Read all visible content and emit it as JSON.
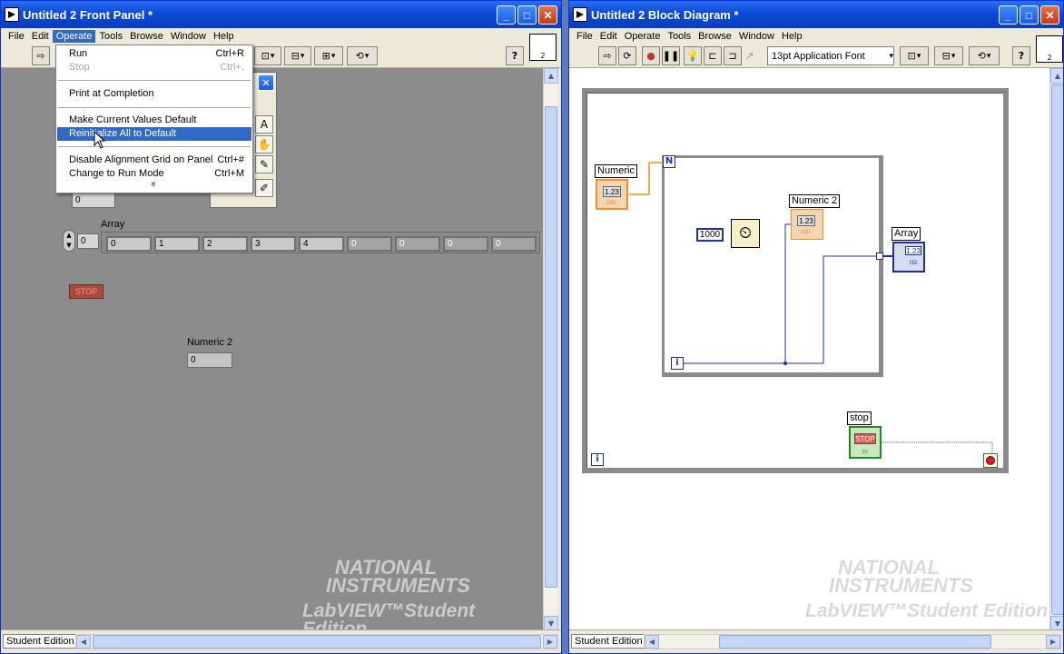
{
  "front_panel": {
    "title": "Untitled 2 Front Panel *",
    "menu": [
      "File",
      "Edit",
      "Operate",
      "Tools",
      "Browse",
      "Window",
      "Help"
    ],
    "operate_menu": {
      "run": "Run",
      "run_sc": "Ctrl+R",
      "stop": "Stop",
      "stop_sc": "Ctrl+.",
      "print": "Print at Completion",
      "make_default": "Make Current Values Default",
      "reinit": "Reinitialize All to Default",
      "disable_grid": "Disable Alignment Grid on Panel",
      "disable_grid_sc": "Ctrl+#",
      "run_mode": "Change to Run Mode",
      "run_mode_sc": "Ctrl+M",
      "more": "»"
    },
    "numeric_value": "0",
    "array_label": "Array",
    "array_index": "0",
    "array_values": [
      "0",
      "1",
      "2",
      "3",
      "4",
      "0",
      "0",
      "0",
      "0"
    ],
    "stop_label": "STOP",
    "numeric2_label": "Numeric 2",
    "numeric2_value": "0",
    "statusbar_label": "Student Edition",
    "vi_icon_number": "2",
    "watermark_line1": "NATIONAL",
    "watermark_line2": "INSTRUMENTS",
    "watermark_line3": "LabVIEW™Student Edition"
  },
  "block_diagram": {
    "title": "Untitled 2 Block Diagram *",
    "menu": [
      "File",
      "Edit",
      "Operate",
      "Tools",
      "Browse",
      "Window",
      "Help"
    ],
    "font_select": "13pt Application Font",
    "numeric_label": "Numeric",
    "numeric_term": "1.23",
    "numeric_type": "DBL",
    "loop_count": "N",
    "loop_index": "i",
    "wait_const": "1000",
    "numeric2_label": "Numeric 2",
    "numeric2_term": "1.23",
    "numeric2_type": "DBL",
    "array_label": "Array",
    "array_term": "1.23",
    "array_type": "I32",
    "stop_label": "stop",
    "stop_term": "STOP",
    "stop_type": "TF",
    "while_index": "i",
    "statusbar_label": "Student Edition",
    "vi_icon_number": "2",
    "watermark_line1": "NATIONAL",
    "watermark_line2": "INSTRUMENTS",
    "watermark_line3": "LabVIEW™Student Edition"
  },
  "colors": {
    "titlebar": "#0a4ad6",
    "menu_highlight": "#316ac5",
    "double_wire": "#f78c1f",
    "int_wire": "#1c2eac",
    "bool_wire": "#1f8a1f"
  }
}
